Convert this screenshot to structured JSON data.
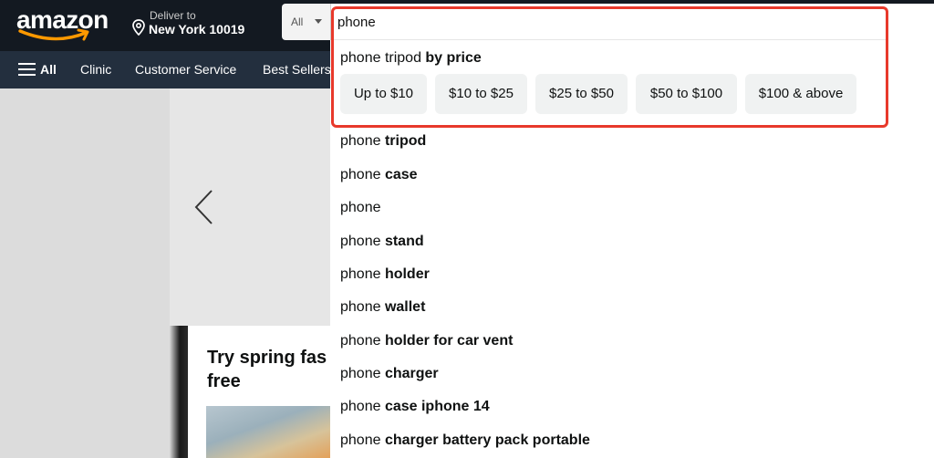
{
  "header": {
    "logo_text": "amazon",
    "deliver_line1": "Deliver to",
    "deliver_line2": "New York 10019",
    "search_category": "All",
    "search_value": "phone"
  },
  "subnav": {
    "all_label": "All",
    "links": [
      "Clinic",
      "Customer Service",
      "Best Sellers"
    ]
  },
  "card": {
    "title_line1": "Try spring fas",
    "title_line2": "free"
  },
  "dropdown": {
    "price_heading": {
      "prefix": "phone tripod ",
      "bold": "by price"
    },
    "price_filters": [
      "Up to $10",
      "$10 to $25",
      "$25 to $50",
      "$50 to $100",
      "$100 & above"
    ],
    "suggestions": [
      {
        "prefix": "phone ",
        "bold": "tripod"
      },
      {
        "prefix": "phone ",
        "bold": "case"
      },
      {
        "prefix": "phone",
        "bold": ""
      },
      {
        "prefix": "phone ",
        "bold": "stand"
      },
      {
        "prefix": "phone ",
        "bold": "holder"
      },
      {
        "prefix": "phone ",
        "bold": "wallet"
      },
      {
        "prefix": "phone ",
        "bold": "holder for car vent"
      },
      {
        "prefix": "phone ",
        "bold": "charger"
      },
      {
        "prefix": "phone ",
        "bold": "case iphone 14"
      },
      {
        "prefix": "phone ",
        "bold": "charger battery pack portable"
      }
    ]
  },
  "colors": {
    "nav_dark": "#131921",
    "nav_secondary": "#232f3e",
    "logo_smile": "#ff9900",
    "highlight_outline": "#e8392b"
  }
}
